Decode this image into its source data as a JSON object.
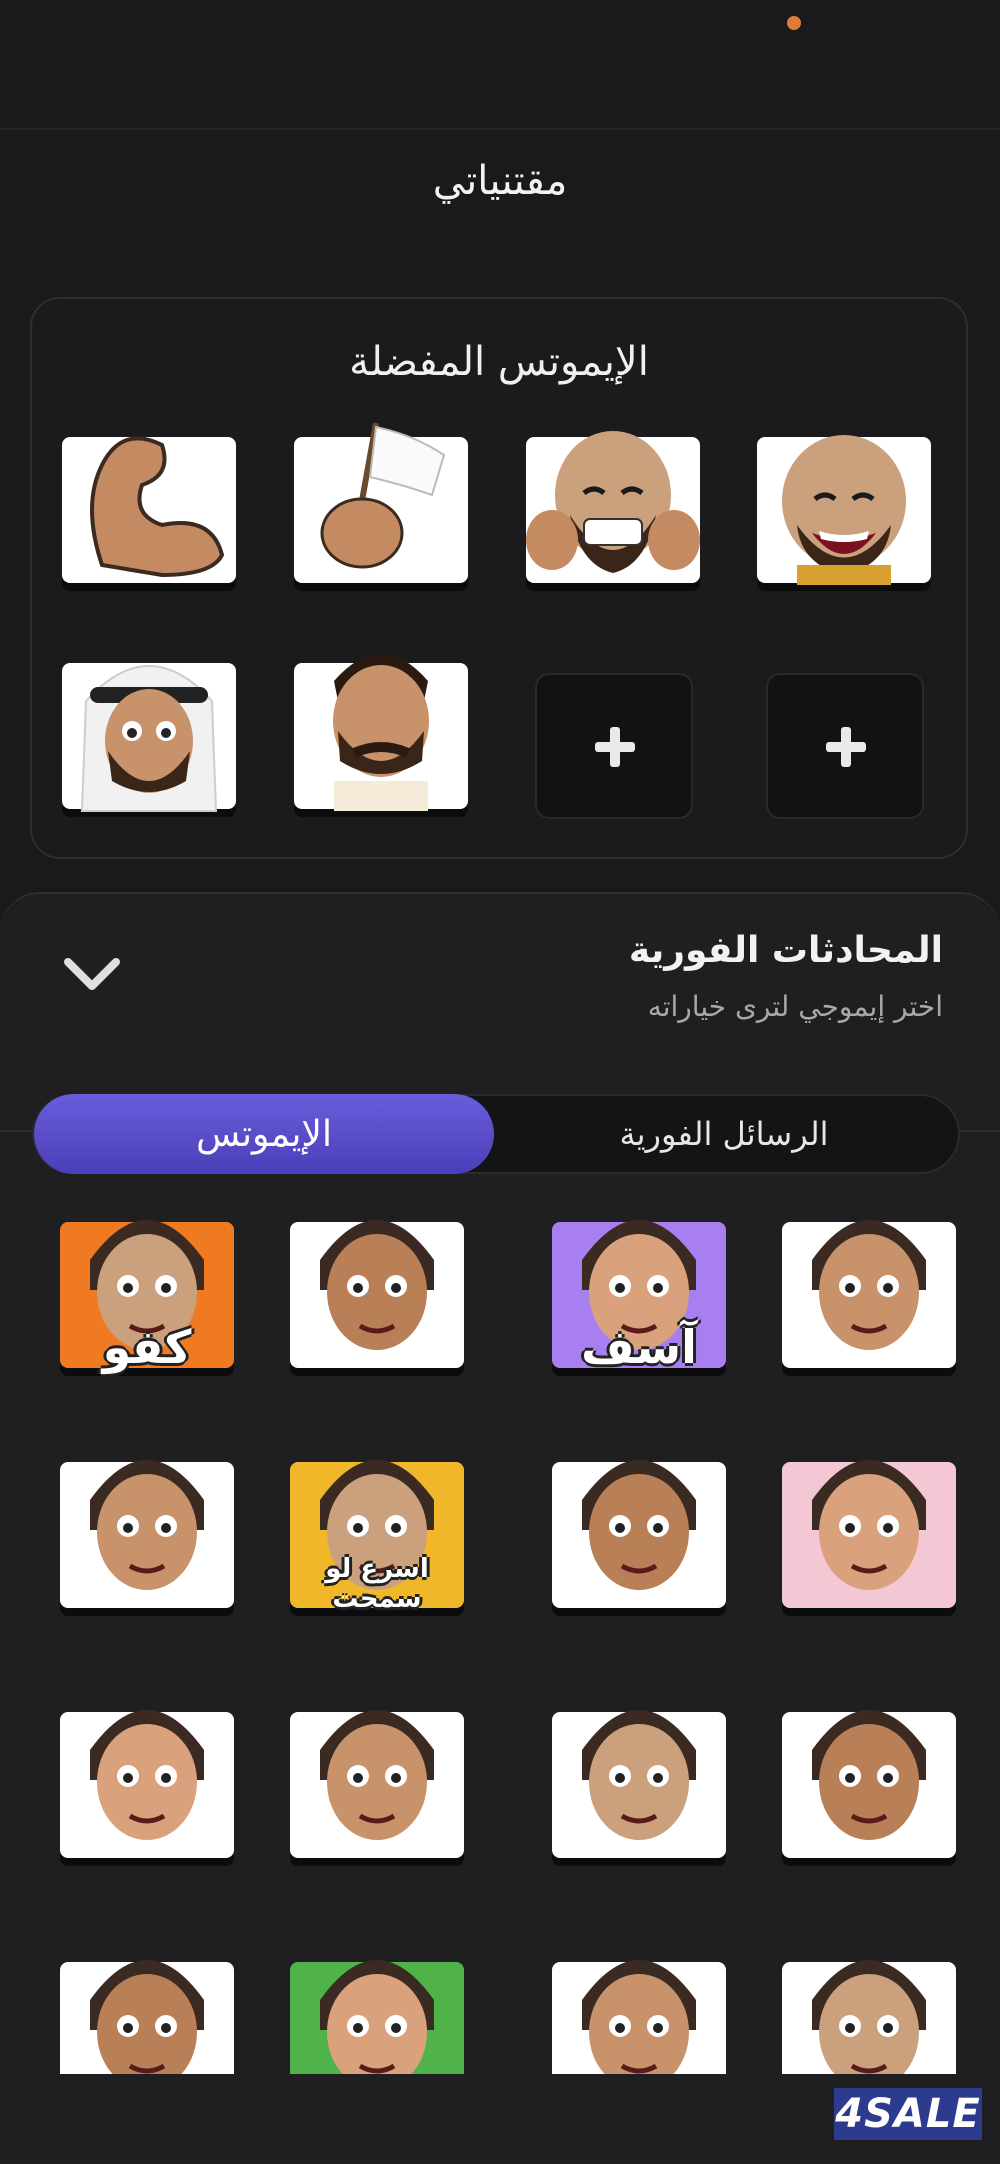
{
  "header": {
    "title": "مقتنياتي"
  },
  "favorites": {
    "title": "الإيموتس المفضلة",
    "items": [
      {
        "name": "flexed-arm-sticker",
        "bg": "#ffffff"
      },
      {
        "name": "white-flag-sticker",
        "bg": "#ffffff"
      },
      {
        "name": "grinning-bald-thumbs-sticker",
        "bg": "#ffffff"
      },
      {
        "name": "laughing-bald-sticker",
        "bg": "#ffffff"
      },
      {
        "name": "crying-ghutra-sticker",
        "bg": "#ffffff"
      },
      {
        "name": "mustache-man-sticker",
        "bg": "#ffffff"
      }
    ],
    "empty_slots": 2
  },
  "sheet": {
    "title": "المحادثات الفورية",
    "subtitle": "اختر إيموجي لترى خياراته",
    "tabs": {
      "active": "الإيموتس",
      "inactive": "الرسائل الفورية"
    }
  },
  "grid": {
    "rows": [
      [
        {
          "name": "girl-grey-hood-nail-bite-sticker",
          "bg": "#ffffff"
        },
        {
          "name": "sorry-bearded-sticker",
          "bg": "#a77ff0",
          "caption": "آسف"
        },
        {
          "name": "crying-tired-man-sticker",
          "bg": "#ffffff"
        },
        {
          "name": "kafo-woman-sticker",
          "bg": "#f07a22",
          "caption": "كفو"
        }
      ],
      [
        {
          "name": "angry-red-shemagh-sticker",
          "bg": "#f3c7d3"
        },
        {
          "name": "woman-cookie-sticker",
          "bg": "#ffffff"
        },
        {
          "name": "hurry-up-bald-sticker",
          "bg": "#f1b72a",
          "caption": "اسرع لو سمحت"
        },
        {
          "name": "curly-tea-sticker",
          "bg": "#ffffff"
        }
      ],
      [
        {
          "name": "hooded-girl-lip-bite-sticker",
          "bg": "#ffffff"
        },
        {
          "name": "laughing-cards-man-sticker",
          "bg": "#ffffff"
        },
        {
          "name": "hooded-girl-cover-sticker",
          "bg": "#ffffff"
        },
        {
          "name": "woman-heart-sticker",
          "bg": "#ffffff"
        }
      ],
      [
        {
          "name": "birthday-candles-sticker",
          "bg": "#ffffff"
        },
        {
          "name": "red-can-sticker",
          "bg": "#ffffff"
        },
        {
          "name": "heart-eyes-ghutra-sticker",
          "bg": "#4fb34a"
        },
        {
          "name": "woman-smirk-sticker",
          "bg": "#ffffff"
        }
      ]
    ]
  },
  "brand": {
    "logo": "4SALE"
  },
  "colors": {
    "accent": "#5b4fd0",
    "status_dot": "#e07b39",
    "background": "#1a1a1c"
  }
}
